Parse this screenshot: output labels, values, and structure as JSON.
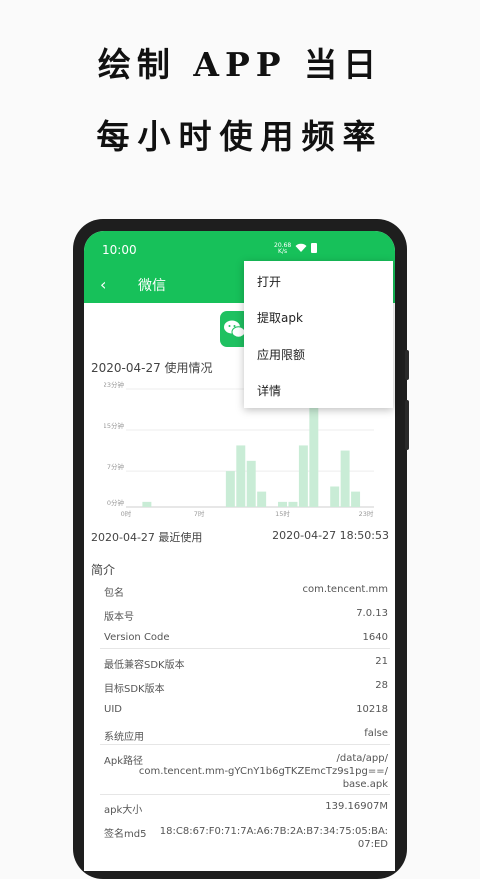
{
  "headline": {
    "line1": "绘制 APP 当日",
    "line2": "每小时使用频率"
  },
  "status_bar": {
    "time": "10:00",
    "net_speed": "20.68",
    "net_unit": "K/s",
    "icons": [
      "wifi-icon",
      "battery-icon"
    ]
  },
  "app_bar": {
    "back_icon": "‹",
    "title": "微信"
  },
  "menu": {
    "items": [
      "打开",
      "提取apk",
      "应用限额",
      "详情"
    ]
  },
  "usage": {
    "title": "2020-04-27 使用情况",
    "last_used_label": "2020-04-27 最近使用",
    "last_used_value": "2020-04-27 18:50:53"
  },
  "intro": {
    "title": "简介",
    "rows": [
      {
        "label": "包名",
        "value": "com.tencent.mm"
      },
      {
        "label": "版本号",
        "value": "7.0.13"
      },
      {
        "label": "Version Code",
        "value": "1640"
      },
      {
        "label": "最低兼容SDK版本",
        "value": "21"
      },
      {
        "label": "目标SDK版本",
        "value": "28"
      },
      {
        "label": "UID",
        "value": "10218"
      },
      {
        "label": "系统应用",
        "value": "false"
      }
    ],
    "apk_path_label": "Apk路径",
    "apk_path_lines": [
      "/data/app/",
      "com.tencent.mm-gYCnY1b6gTKZEmcTz9s1pg==/",
      "base.apk"
    ],
    "apk_size_label": "apk大小",
    "apk_size_value": "139.16907M",
    "md5_label": "签名md5",
    "md5_lines": [
      "18:C8:67:F0:71:7A:A6:7B:2A:B7:34:75:05:BA:",
      "07:ED"
    ]
  },
  "chart_data": {
    "type": "bar",
    "categories": [
      "0",
      "1",
      "2",
      "3",
      "4",
      "5",
      "6",
      "7",
      "8",
      "9",
      "10",
      "11",
      "12",
      "13",
      "14",
      "15",
      "16",
      "17",
      "18",
      "19",
      "20",
      "21",
      "22",
      "23"
    ],
    "values": [
      0,
      0,
      1,
      0,
      0,
      0,
      0,
      0,
      0,
      0,
      7,
      12,
      9,
      3,
      0,
      1,
      1,
      12,
      24,
      0,
      4,
      11,
      3,
      0
    ],
    "ylim": [
      0,
      23
    ],
    "yticks": [
      "0分钟",
      "7分钟",
      "15分钟",
      "23分钟"
    ],
    "ytick_values": [
      0,
      7,
      15,
      23
    ],
    "xticks": [
      "0时",
      "7时",
      "15时",
      "23时"
    ],
    "xtick_positions": [
      0,
      7,
      15,
      23
    ],
    "bar_color": "#c9ecd6",
    "grid": true
  }
}
